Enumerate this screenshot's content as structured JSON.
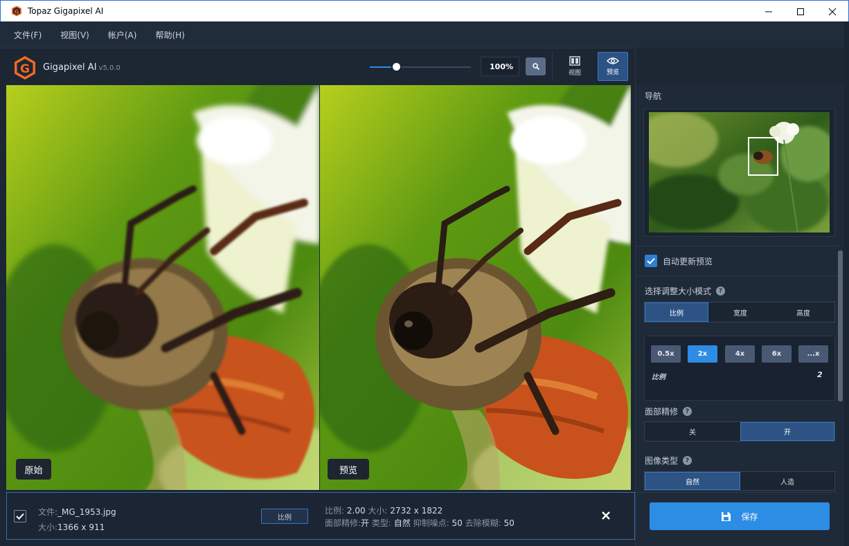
{
  "window": {
    "title": "Topaz Gigapixel AI",
    "controls": [
      "minimize",
      "maximize",
      "close"
    ]
  },
  "menu": {
    "items": [
      "文件(F)",
      "视图(V)",
      "帐户(A)",
      "帮助(H)"
    ]
  },
  "toolbar": {
    "brand": "Gigapixel AI",
    "version": "v5.0.0",
    "zoom_fraction": 0.26,
    "zoom_value": "100%",
    "view_label": "视图",
    "preview_label": "预览"
  },
  "viewer": {
    "left_label": "原始",
    "right_label": "预览"
  },
  "sidebar": {
    "nav_title": "导航",
    "auto_update_label": "自动更新预览",
    "auto_update_checked": true,
    "resize_mode_label": "选择调整大小模式",
    "resize_modes": [
      "比例",
      "宽度",
      "高度"
    ],
    "resize_mode_active": 0,
    "scale_options": [
      "0.5x",
      "2x",
      "4x",
      "6x",
      "...x"
    ],
    "scale_active": 1,
    "ratio_label": "比例",
    "ratio_value": "2",
    "face_refine_label": "面部精修",
    "face_refine_options": [
      "关",
      "开"
    ],
    "face_refine_active": 1,
    "image_type_label": "图像类型",
    "image_type_options": [
      "自然",
      "人造"
    ],
    "image_type_active": 0
  },
  "file_bar": {
    "checked": true,
    "file_label": "文件:",
    "file_name": "_MG_1953.jpg",
    "size_label": "大小:",
    "size_value": "1366 x 911",
    "mode_badge": "比例",
    "out_ratio_label": "比例:",
    "out_ratio_value": "2.00",
    "out_size_label": "大小:",
    "out_size_value": "2732 x 1822",
    "face_label": "面部精修:",
    "face_value": "开",
    "type_label": "类型:",
    "type_value": "自然",
    "noise_label": "抑制噪点:",
    "noise_value": "50",
    "blur_label": "去除模糊:",
    "blur_value": "50"
  },
  "save_button": {
    "label": "保存"
  },
  "colors": {
    "accent": "#2d8ce4",
    "active_segment": "#2c5384",
    "panel_bg": "#1f2a39",
    "app_bg": "#1c2634",
    "brand_orange": "#f26b21"
  }
}
